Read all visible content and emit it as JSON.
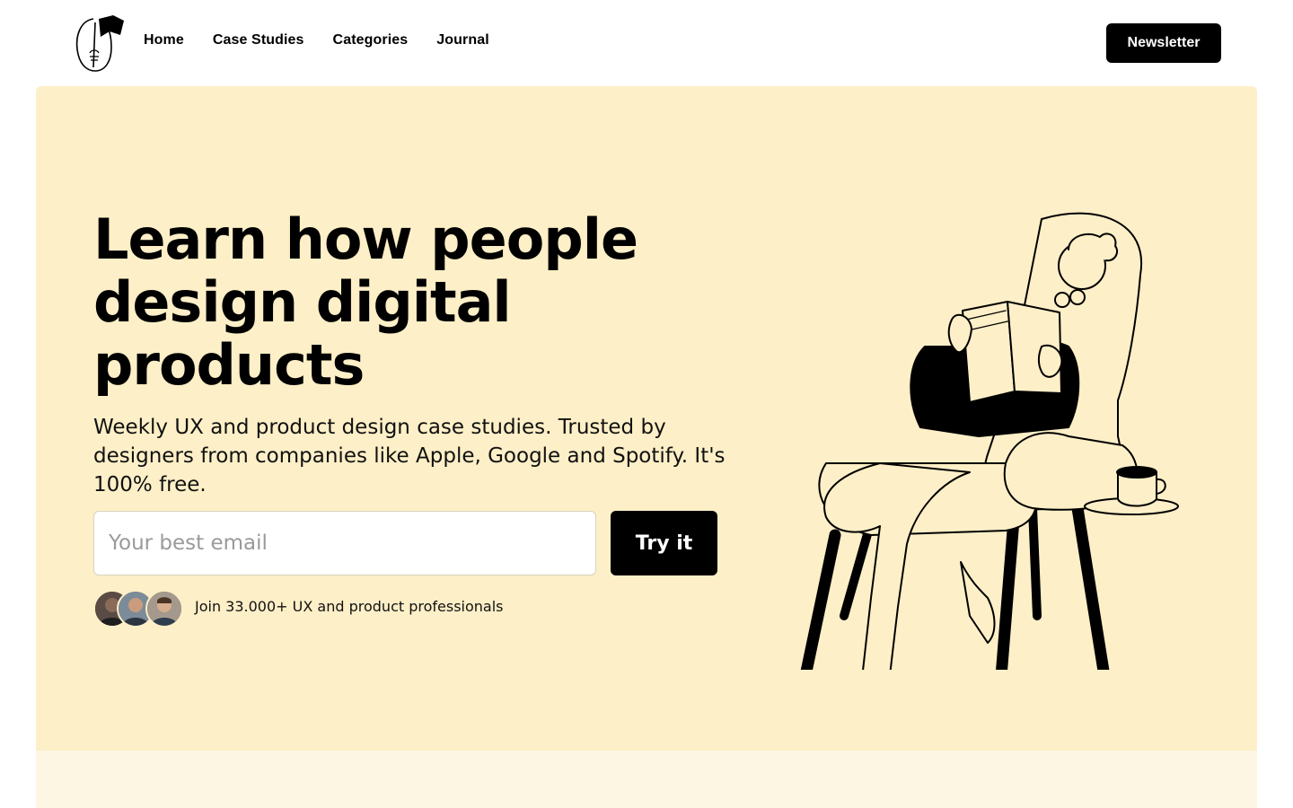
{
  "header": {
    "logo_icon": "flag-holding-person-logo",
    "nav": [
      {
        "label": "Home"
      },
      {
        "label": "Case Studies"
      },
      {
        "label": "Categories"
      },
      {
        "label": "Journal"
      }
    ],
    "newsletter_label": "Newsletter"
  },
  "hero": {
    "headline": "Learn how people design digital products",
    "subtext": "Weekly UX and product design case studies. Trusted by designers from companies like Apple, Google and Spotify. It's 100% free.",
    "email_placeholder": "Your best email",
    "email_value": "",
    "cta_label": "Try it",
    "social_proof": "Join 33.000+ UX and product professionals",
    "avatars": [
      "avatar-1",
      "avatar-2",
      "avatar-3"
    ],
    "illustration": "person-reading-in-armchair"
  },
  "colors": {
    "hero_bg": "#fdefc7",
    "lower_bg": "#fdf6e3",
    "button_bg": "#000000",
    "button_text": "#ffffff"
  }
}
